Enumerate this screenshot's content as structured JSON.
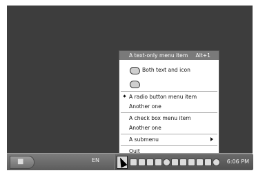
{
  "menu": {
    "header": {
      "label": "A text-only menu item",
      "accelerator": "Alt+1"
    },
    "items": [
      {
        "label": "Both text and icon",
        "icon": "cloud-icon"
      },
      {
        "label": "",
        "icon": "cloud-icon"
      },
      {
        "label": "A radio button menu item",
        "selected": true
      },
      {
        "label": "Another one"
      },
      {
        "label": "A check box menu item"
      },
      {
        "label": "Another one"
      },
      {
        "label": "A submenu",
        "icon": "chevron-right-icon"
      },
      {
        "label": "Quit"
      }
    ]
  },
  "taskbar": {
    "language": "EN",
    "clock": "6:06 PM"
  }
}
